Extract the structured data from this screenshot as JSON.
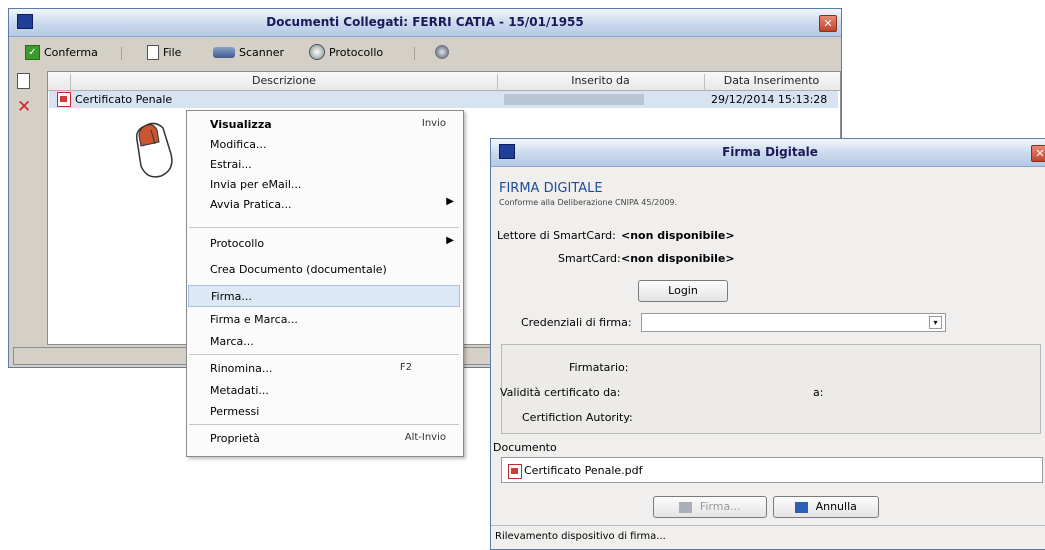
{
  "main_window": {
    "title": "Documenti Collegati: FERRI CATIA - 15/01/1955",
    "close": "✕",
    "toolbar": {
      "conferma": "Conferma",
      "file": "File",
      "scanner": "Scanner",
      "protocollo": "Protocollo"
    },
    "grid": {
      "columns": [
        "Descrizione",
        "Inserito da",
        "Data Inserimento"
      ],
      "rows": [
        {
          "descrizione": "Certificato Penale",
          "inserito_da": "",
          "data": "29/12/2014 15:13:28"
        }
      ]
    }
  },
  "context_menu": {
    "items": [
      {
        "label": "Visualizza",
        "shortcut": "Invio",
        "bold": true
      },
      {
        "label": "Modifica..."
      },
      {
        "label": "Estrai..."
      },
      {
        "label": "Invia per eMail..."
      },
      {
        "label": "Avvia Pratica...",
        "submenu": true
      },
      {
        "label": "Protocollo",
        "submenu": true
      },
      {
        "label": "Crea Documento (documentale)"
      },
      {
        "label": "Firma...",
        "selected": true
      },
      {
        "label": "Firma e Marca..."
      },
      {
        "label": "Marca..."
      },
      {
        "label": "Rinomina...",
        "shortcut": "F2"
      },
      {
        "label": "Metadati..."
      },
      {
        "label": "Permessi"
      },
      {
        "label": "Proprietà",
        "shortcut": "Alt-Invio"
      }
    ]
  },
  "dialog": {
    "title": "Firma Digitale",
    "close": "✕",
    "header_title": "FIRMA DIGITALE",
    "header_subtitle": "Conforme alla Deliberazione CNIPA 45/2009.",
    "reader_label": "Lettore di SmartCard:",
    "reader_value": "<non disponibile>",
    "card_label": "SmartCard:",
    "card_value": "<non disponibile>",
    "login_button": "Login",
    "credentials_label": "Credenziali di firma:",
    "credentials_value": "",
    "firmatario_label": "Firmatario:",
    "validita_label": "Validità certificato da:",
    "a_label": "a:",
    "certification_label": "Certifiction Autority:",
    "documento_label": "Documento",
    "document_name": "Certificato Penale.pdf",
    "firma_button": "Firma...",
    "annulla_button": "Annulla",
    "status": "Rilevamento dispositivo di firma..."
  }
}
